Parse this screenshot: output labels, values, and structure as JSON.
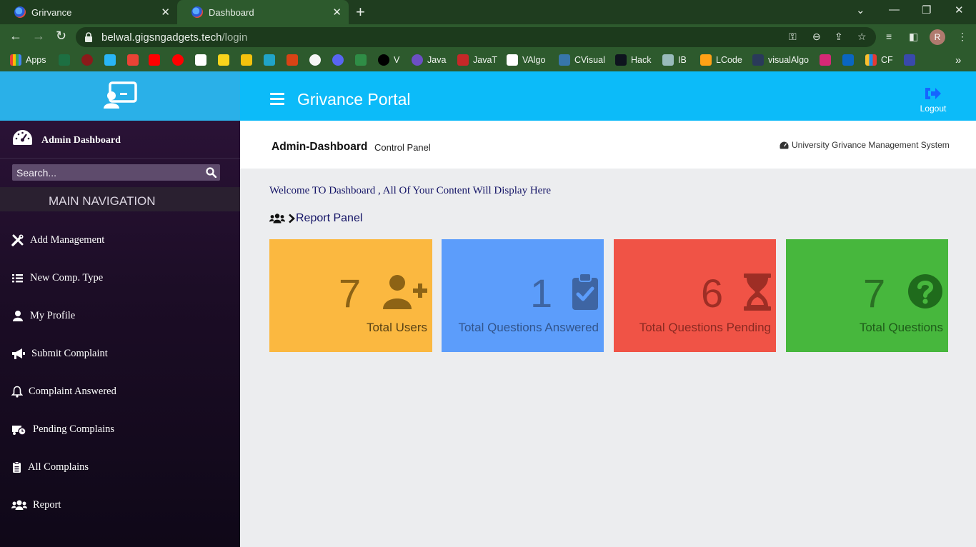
{
  "browser": {
    "tabs": [
      {
        "label": "Grirvance"
      },
      {
        "label": "Dashboard"
      }
    ],
    "url_host": "belwal.gigsngadgets.tech",
    "url_path": "/login",
    "profile_initial": "R",
    "bookmarks": [
      "Apps",
      "V",
      "Java",
      "JavaT",
      "VAlgo",
      "CVisual",
      "Hack",
      "IB",
      "LCode",
      "visualAlgo",
      "CF"
    ]
  },
  "header": {
    "title": "Grivance Portal",
    "logout_label": "Logout"
  },
  "sidebar": {
    "admin_label": "Admin Dashboard",
    "search_placeholder": "Search...",
    "section_label": "MAIN NAVIGATION",
    "items": [
      {
        "label": "Add Management",
        "icon": "tools-icon"
      },
      {
        "label": "New Comp. Type",
        "icon": "list-icon"
      },
      {
        "label": "My Profile",
        "icon": "user-icon"
      },
      {
        "label": "Submit Complaint",
        "icon": "bullhorn-icon"
      },
      {
        "label": "Complaint Answered",
        "icon": "bell-icon"
      },
      {
        "label": "Pending Complains",
        "icon": "truck-clock-icon"
      },
      {
        "label": "All Complains",
        "icon": "clipboard-icon"
      },
      {
        "label": "Report",
        "icon": "users-icon"
      }
    ]
  },
  "content": {
    "title": "Admin-Dashboard",
    "subtitle": "Control Panel",
    "system_name": "University Grivance Management System",
    "welcome": "Welcome TO Dashboard , All Of Your Content Will Display Here",
    "report_panel": "Report Panel",
    "cards": [
      {
        "value": "7",
        "label": "Total Users",
        "color": "#fbb840",
        "icon": "user-plus-icon"
      },
      {
        "value": "1",
        "label": "Total Questions Answered",
        "color": "#5c9dfb",
        "icon": "clipboard-check-icon"
      },
      {
        "value": "6",
        "label": "Total Questions Pending",
        "color": "#f05346",
        "icon": "hourglass-icon"
      },
      {
        "value": "7",
        "label": "Total Questions",
        "color": "#47b73d",
        "icon": "question-circle-icon"
      }
    ]
  }
}
